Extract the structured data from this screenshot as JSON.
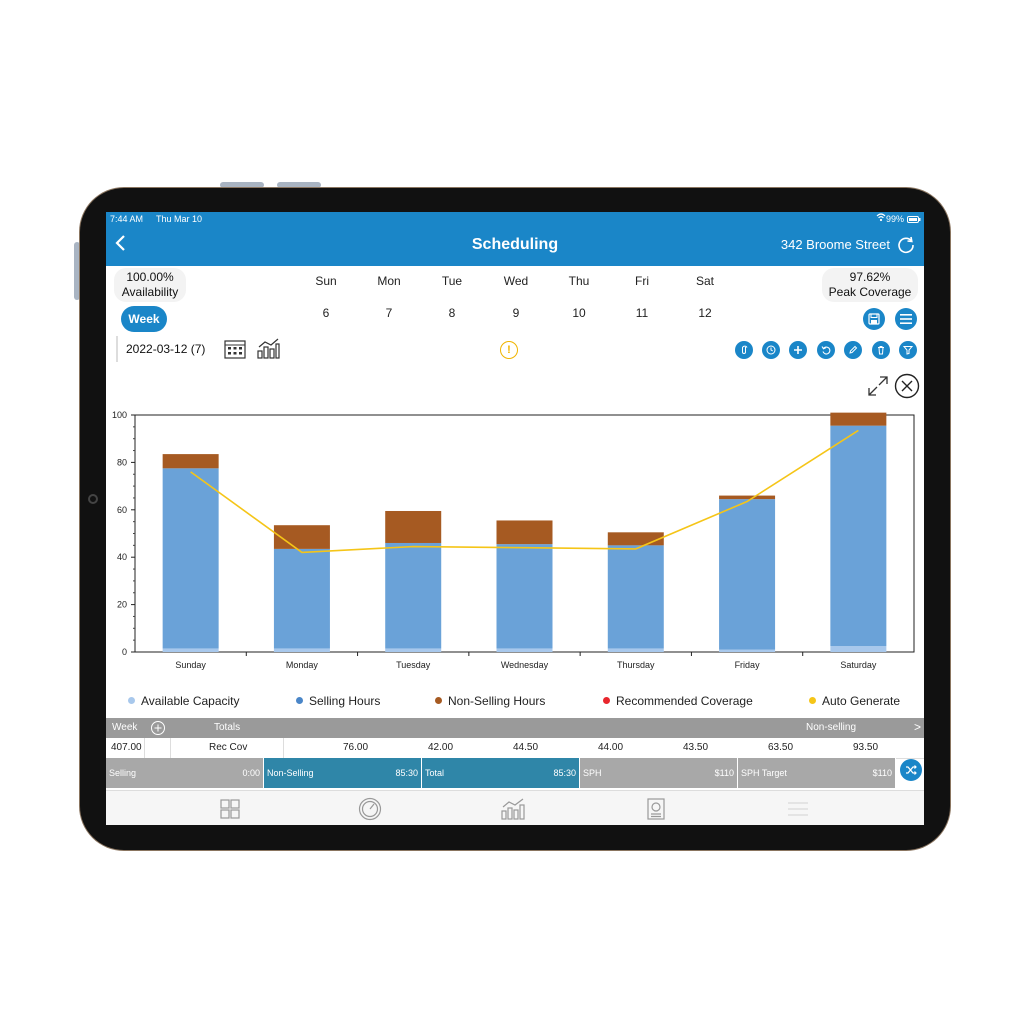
{
  "status_bar": {
    "time": "7:44 AM",
    "date": "Thu Mar 10",
    "battery": "99%"
  },
  "header": {
    "back_icon": "chevron-left-icon",
    "title": "Scheduling",
    "store": "342 Broome Street",
    "refresh_icon": "refresh-icon"
  },
  "availability": {
    "value": "100.00%",
    "label": "Availability"
  },
  "peak": {
    "value": "97.62%",
    "label": "Peak Coverage"
  },
  "days": [
    {
      "name": "Sun",
      "num": "6"
    },
    {
      "name": "Mon",
      "num": "7"
    },
    {
      "name": "Tue",
      "num": "8"
    },
    {
      "name": "Wed",
      "num": "9"
    },
    {
      "name": "Thu",
      "num": "10"
    },
    {
      "name": "Fri",
      "num": "11"
    },
    {
      "name": "Sat",
      "num": "12"
    }
  ],
  "week_button": "Week",
  "date_label": "2022-03-12 (7)",
  "warning_glyph": "!",
  "actions": [
    "attach-icon",
    "clock-icon",
    "plus-icon",
    "undo-icon",
    "pencil-icon",
    "trash-icon",
    "filter-icon"
  ],
  "top_actions": [
    "save-icon",
    "menu-icon"
  ],
  "chart_data": {
    "type": "bar",
    "categories": [
      "Sunday",
      "Monday",
      "Tuesday",
      "Wednesday",
      "Thursday",
      "Friday",
      "Saturday"
    ],
    "ylim": [
      0,
      100
    ],
    "yticks": [
      "0",
      "20",
      "40",
      "60",
      "80",
      "100"
    ],
    "series": [
      {
        "name": "Available Capacity",
        "values": [
          1.5,
          1.5,
          1.5,
          1.5,
          1.5,
          1.0,
          2.5
        ],
        "color": "#a8c8ec"
      },
      {
        "name": "Selling Hours",
        "values": [
          76.0,
          42.0,
          44.5,
          44.0,
          43.5,
          63.5,
          93.0
        ],
        "color": "#6aa2d8"
      },
      {
        "name": "Non-Selling Hours",
        "values": [
          6.0,
          10.0,
          13.5,
          10.0,
          5.5,
          1.5,
          5.5
        ],
        "color": "#a65a22"
      },
      {
        "name": "Recommended Coverage",
        "values": [],
        "color": "#e8262d"
      },
      {
        "name": "Auto Generate",
        "values": [
          76.0,
          42.0,
          44.5,
          44.0,
          43.5,
          63.5,
          93.5
        ],
        "color": "#f5c518",
        "line": true
      }
    ],
    "legend": [
      "Available Capacity",
      "Selling Hours",
      "Non-Selling Hours",
      "Recommended Coverage",
      "Auto Generate"
    ]
  },
  "week_header": {
    "week": "Week",
    "totals": "Totals",
    "non_selling": "Non-selling",
    "arrow": ">"
  },
  "rec_row": {
    "total": "407.00",
    "label": "Rec Cov",
    "values": [
      "76.00",
      "42.00",
      "44.50",
      "44.00",
      "43.50",
      "63.50",
      "93.50"
    ]
  },
  "summary": [
    {
      "label": "Selling",
      "value": "0:00",
      "color": "#a8a8a8"
    },
    {
      "label": "Non-Selling",
      "value": "85:30",
      "color": "#2f86a8"
    },
    {
      "label": "Total",
      "value": "85:30",
      "color": "#2f86a8"
    },
    {
      "label": "SPH",
      "value": "$110",
      "color": "#a8a8a8"
    },
    {
      "label": "SPH Target",
      "value": "$110",
      "color": "#a8a8a8"
    }
  ],
  "tabs": [
    "dashboard-icon",
    "speedometer-icon",
    "chart-icon",
    "report-icon",
    "hamburger-icon"
  ]
}
